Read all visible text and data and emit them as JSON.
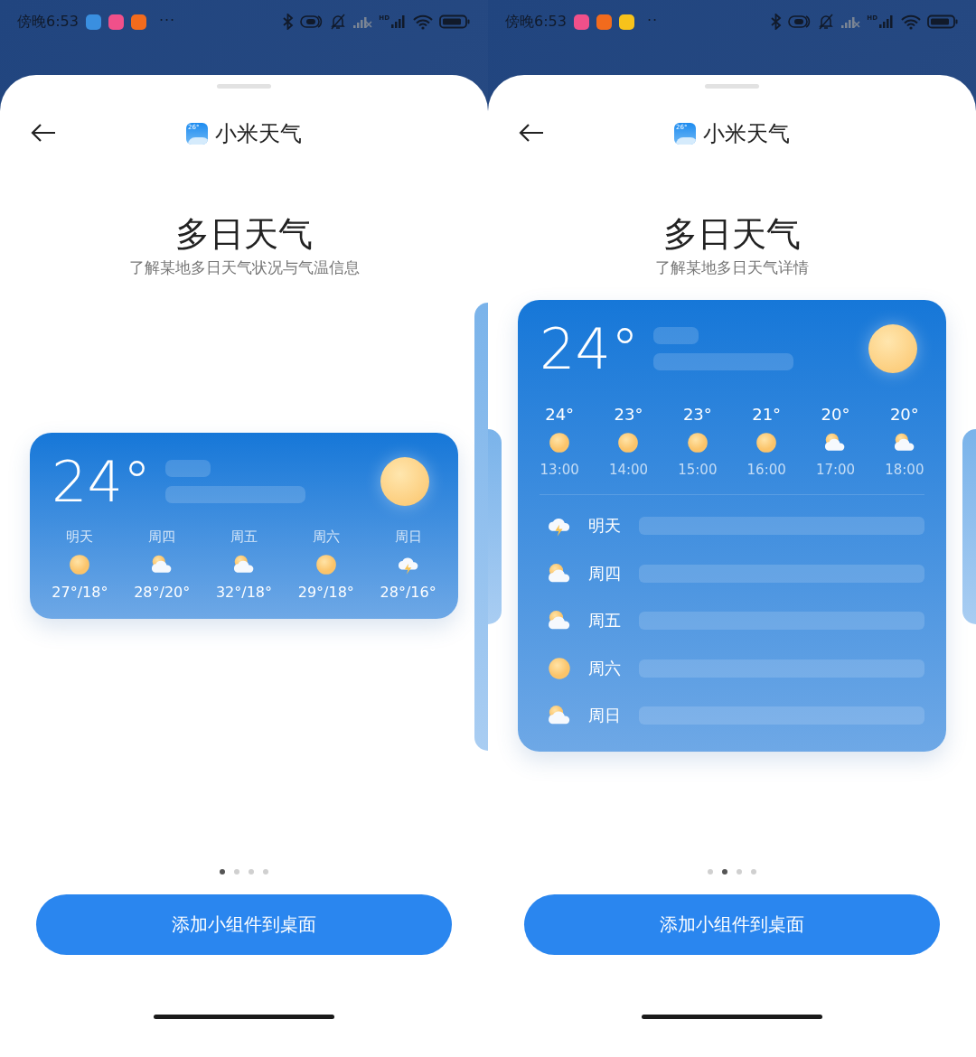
{
  "screens": [
    {
      "status_bar": {
        "time": "傍晚6:53",
        "notification_icons": [
          {
            "color": "#3a8fe0"
          },
          {
            "color": "#f0508a"
          },
          {
            "color": "#f26b1d"
          }
        ],
        "more": "···",
        "hd_label": "HD"
      },
      "header": {
        "app_icon_text": "26°",
        "app_name": "小米天气"
      },
      "title": "多日天气",
      "subtitle": "了解某地多日天气状况与气温信息",
      "widget": {
        "kind": "daily",
        "temperature": "24°",
        "days": [
          {
            "label": "明天",
            "kind": "sun",
            "temps": "27°/18°"
          },
          {
            "label": "周四",
            "kind": "cloudy",
            "temps": "28°/20°"
          },
          {
            "label": "周五",
            "kind": "cloudy",
            "temps": "32°/18°"
          },
          {
            "label": "周六",
            "kind": "sun",
            "temps": "29°/18°"
          },
          {
            "label": "周日",
            "kind": "storm",
            "temps": "28°/16°"
          }
        ]
      },
      "side_cards": [
        {
          "kind": "right_tall"
        }
      ],
      "page_dots": [
        {
          "selected": true
        },
        {
          "selected": false
        },
        {
          "selected": false
        },
        {
          "selected": false
        }
      ],
      "add_button": "添加小组件到桌面"
    },
    {
      "status_bar": {
        "time": "傍晚6:53",
        "notification_icons": [
          {
            "color": "#f0508a"
          },
          {
            "color": "#f26b1d"
          },
          {
            "color": "#f7c21b"
          }
        ],
        "more": "··",
        "hd_label": "HD"
      },
      "header": {
        "app_icon_text": "26°",
        "app_name": "小米天气"
      },
      "title": "多日天气",
      "subtitle": "了解某地多日天气详情",
      "widget": {
        "kind": "detailed",
        "temperature": "24°",
        "hours": [
          {
            "temp": "24°",
            "kind": "sun",
            "time": "13:00"
          },
          {
            "temp": "23°",
            "kind": "sun",
            "time": "14:00"
          },
          {
            "temp": "23°",
            "kind": "sun",
            "time": "15:00"
          },
          {
            "temp": "21°",
            "kind": "sun",
            "time": "16:00"
          },
          {
            "temp": "20°",
            "kind": "cloudy",
            "time": "17:00"
          },
          {
            "temp": "20°",
            "kind": "cloudy",
            "time": "18:00"
          }
        ],
        "days": [
          {
            "label": "明天",
            "kind": "storm"
          },
          {
            "label": "周四",
            "kind": "cloudy"
          },
          {
            "label": "周五",
            "kind": "cloudy"
          },
          {
            "label": "周六",
            "kind": "sun"
          },
          {
            "label": "周日",
            "kind": "cloudy"
          }
        ]
      },
      "side_cards": [
        {
          "kind": "right_short"
        },
        {
          "kind": "left_short"
        }
      ],
      "page_dots": [
        {
          "selected": false
        },
        {
          "selected": true
        },
        {
          "selected": false
        },
        {
          "selected": false
        }
      ],
      "add_button": "添加小组件到桌面"
    }
  ]
}
